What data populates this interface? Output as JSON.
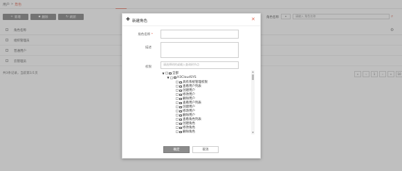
{
  "breadcrumb": {
    "parent": "用户",
    "sep": "»",
    "current": "角色"
  },
  "toolbar": {
    "new_label": "新增",
    "delete_label": "删除",
    "refresh_label": "刷新"
  },
  "search": {
    "field_label": "角色名称",
    "select_value": "▾",
    "placeholder": "请输入 角色名称"
  },
  "table": {
    "header": "角色名称",
    "rows": [
      "组织管理员",
      "普通用户",
      "云管理员"
    ]
  },
  "footer": {
    "summary": "共3条记录，当前第1/1页"
  },
  "pager": [
    "«",
    "‹",
    "1",
    "›",
    "»",
    "10"
  ],
  "modal": {
    "title": "新建角色",
    "close_icon": "close-icon",
    "name_label": "角色名称",
    "required_mark": "*",
    "desc_label": "描述",
    "perm_label": "权限",
    "perm_placeholder": "请选择树的或输入查询树节点",
    "tree": {
      "root": "全部",
      "group": "H3CloudSYS",
      "items": [
        "具有系统管理权限",
        "查看用户列表",
        "创建用户",
        "修改用户",
        "删除用户",
        "查看用户列表",
        "创建用户",
        "修改用户",
        "删除用户",
        "查看角色列表",
        "创建角色",
        "修改角色",
        "删除角色"
      ]
    },
    "ok_label": "确定",
    "cancel_label": "取消"
  },
  "colors": {
    "accent": "#e98c7c",
    "ok_button": "#8c8c8c",
    "close": "#e06650"
  }
}
